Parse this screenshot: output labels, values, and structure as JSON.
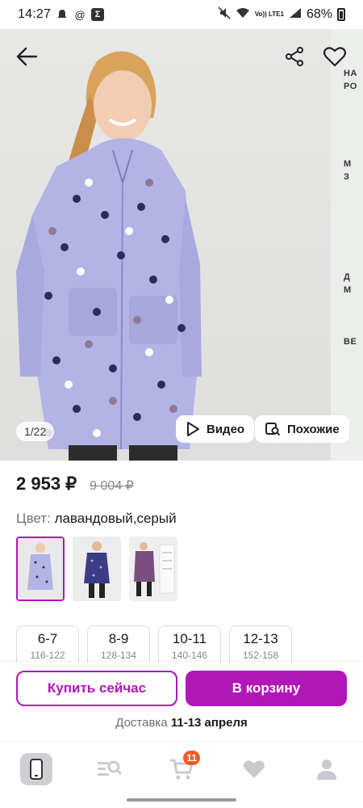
{
  "status_bar": {
    "time": "14:27",
    "battery": "68%",
    "network": "Vo)) LTE1"
  },
  "hero": {
    "counter": "1/22",
    "video_label": "Видео",
    "similar_label": "Похожие",
    "side_labels": [
      "НА",
      "РО",
      "М",
      "З",
      "Д",
      "М",
      "ВЕ"
    ]
  },
  "product": {
    "price": "2 953 ₽",
    "old_price": "9 004 ₽",
    "color_label": "Цвет:",
    "color_value": "лавандовый,серый"
  },
  "sizes": [
    {
      "size": "6-7",
      "height": "116-122"
    },
    {
      "size": "8-9",
      "height": "128-134"
    },
    {
      "size": "10-11",
      "height": "140-146"
    },
    {
      "size": "12-13",
      "height": "152-158"
    }
  ],
  "actions": {
    "buy_now": "Купить сейчас",
    "add_to_cart": "В корзину",
    "delivery_label": "Доставка",
    "delivery_dates": "11-13 апреля"
  },
  "nav": {
    "cart_count": "11"
  },
  "colors": {
    "accent": "#b117b8",
    "badge": "#f55a23",
    "coat": "#b3b3e6"
  }
}
